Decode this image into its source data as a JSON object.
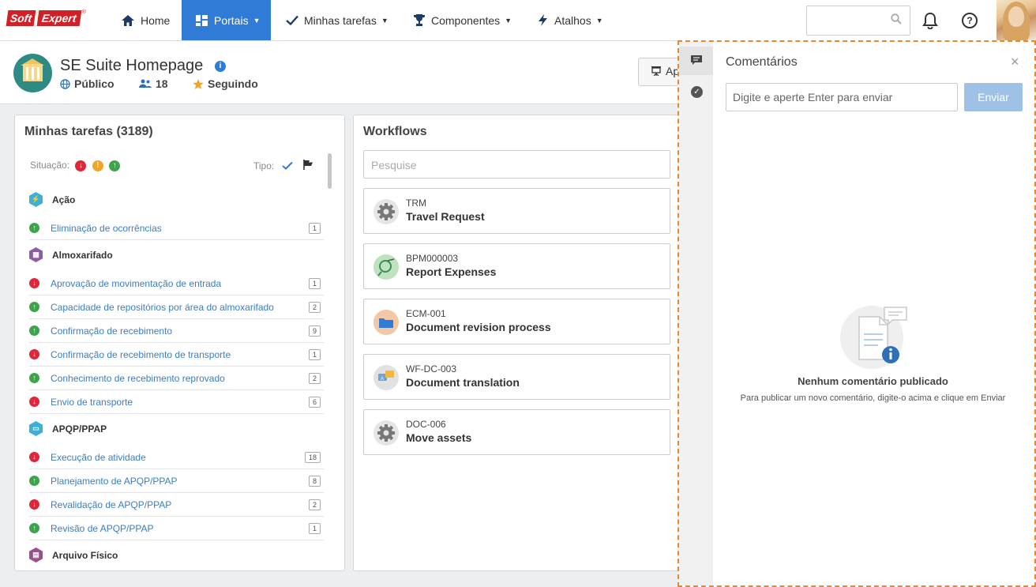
{
  "nav": {
    "logo_soft": "Soft",
    "logo_expert": "Expert",
    "logo_reg": "®",
    "home": "Home",
    "portais": "Portais",
    "minhas_tarefas": "Minhas tarefas",
    "componentes": "Componentes",
    "atalhos": "Atalhos",
    "help": "?"
  },
  "header": {
    "title": "SE Suite Homepage",
    "info": "i",
    "visibility": "Público",
    "members": "18",
    "follow": "Seguindo",
    "ap_button": "Ap"
  },
  "tasks": {
    "title": "Minhas tarefas (3189)",
    "situacao_label": "Situação:",
    "tipo_label": "Tipo:",
    "groups": [
      {
        "label": "Ação",
        "color": "#3bb1d8"
      },
      {
        "label": "Almoxarifado",
        "color": "#8e5ba8"
      },
      {
        "label": "APQP/PPAP",
        "color": "#3bb1d8"
      },
      {
        "label": "Arquivo Físico",
        "color": "#9b4f8c"
      }
    ],
    "items": [
      {
        "label": "Eliminação de ocorrências",
        "count": "1",
        "status": "green"
      },
      {
        "label": "Aprovação de movimentação de entrada",
        "count": "1",
        "status": "red"
      },
      {
        "label": "Capacidade de repositórios por área do almoxarifado",
        "count": "2",
        "status": "green"
      },
      {
        "label": "Confirmação de recebimento",
        "count": "9",
        "status": "green"
      },
      {
        "label": "Confirmação de recebimento de transporte",
        "count": "1",
        "status": "red"
      },
      {
        "label": "Conhecimento de recebimento reprovado",
        "count": "2",
        "status": "green"
      },
      {
        "label": "Envio de transporte",
        "count": "6",
        "status": "red"
      },
      {
        "label": "Execução de atividade",
        "count": "18",
        "status": "red"
      },
      {
        "label": "Planejamento de APQP/PPAP",
        "count": "8",
        "status": "green"
      },
      {
        "label": "Revalidação de APQP/PPAP",
        "count": "2",
        "status": "red"
      },
      {
        "label": "Revisão de APQP/PPAP",
        "count": "1",
        "status": "green"
      }
    ]
  },
  "workflows": {
    "title": "Workflows",
    "search_placeholder": "Pesquise",
    "items": [
      {
        "code": "TRM",
        "name": "Travel Request",
        "icon": "gear-icon"
      },
      {
        "code": "BPM000003",
        "name": "Report Expenses",
        "icon": "expense-icon"
      },
      {
        "code": "ECM-001",
        "name": "Document revision process",
        "icon": "folder-icon"
      },
      {
        "code": "WF-DC-003",
        "name": "Document translation",
        "icon": "translate-icon"
      },
      {
        "code": "DOC-006",
        "name": "Move assets",
        "icon": "gear-icon"
      }
    ]
  },
  "comments": {
    "title": "Comentários",
    "close": "×",
    "input_placeholder": "Digite e aperte Enter para enviar",
    "send": "Enviar",
    "empty_title": "Nenhum comentário publicado",
    "empty_sub": "Para publicar um novo comentário, digite-o acima e clique em Enviar"
  }
}
